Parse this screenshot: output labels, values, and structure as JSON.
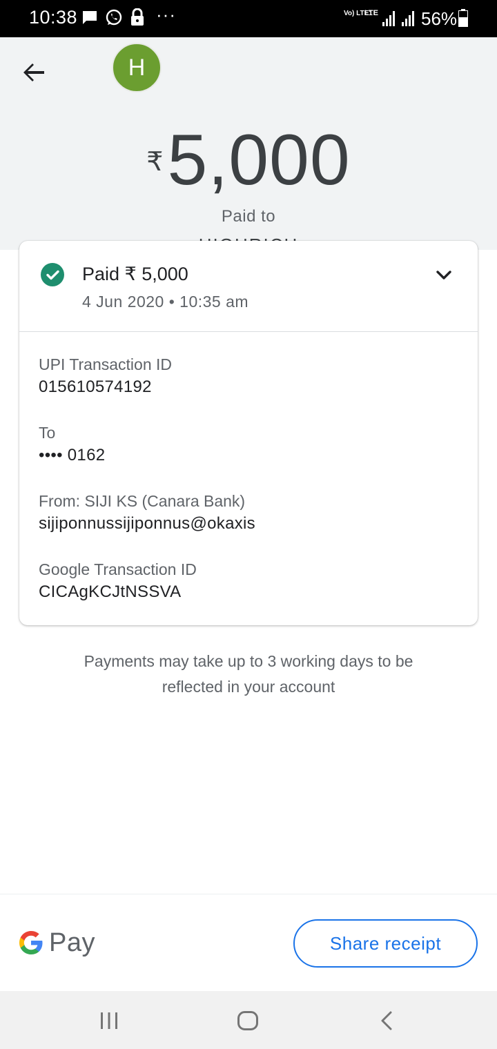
{
  "status_bar": {
    "time": "10:38",
    "network_label": "Vo) LTE1",
    "lte_label": "LTE",
    "battery": "56%",
    "icons": [
      "chat-icon",
      "whatsapp-icon",
      "lock-icon",
      "more-dots-icon"
    ]
  },
  "header": {
    "avatar_letter": "H",
    "currency_symbol": "₹",
    "amount": "5,000",
    "paid_to_label": "Paid to",
    "payee_name": "HIGHRICH"
  },
  "card": {
    "title": "Paid ₹ 5,000",
    "date": "4 Jun 2020 • 10:35 am",
    "status_color": "#1e8e6e",
    "details": [
      {
        "label": "UPI Transaction ID",
        "value": "015610574192"
      },
      {
        "label": "To",
        "value": "•••• 0162"
      },
      {
        "label": "From: SIJI KS (Canara Bank)",
        "value": "sijiponnussijiponnus@okaxis"
      },
      {
        "label": "Google Transaction ID",
        "value": "CICAgKCJtNSSVA"
      }
    ]
  },
  "note": "Payments may take up to 3 working days to be reflected in your account",
  "footer": {
    "brand": "Pay",
    "share_label": "Share receipt",
    "accent": "#1a73e8"
  },
  "nav": {
    "icons": [
      "recent-apps-icon",
      "home-icon",
      "back-nav-icon"
    ]
  }
}
